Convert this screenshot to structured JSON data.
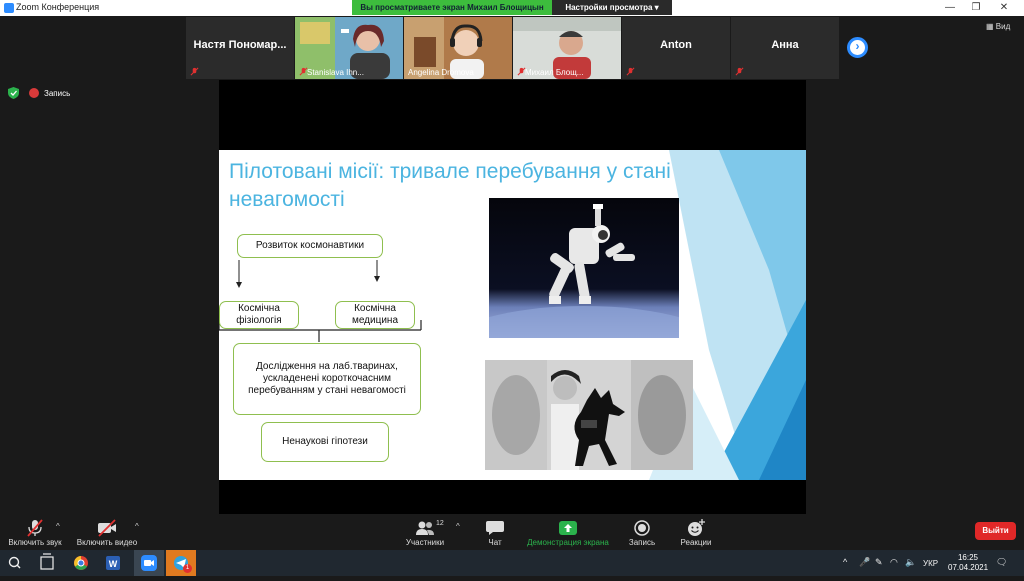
{
  "window": {
    "title": "Zoom Конференция",
    "controls": [
      "—",
      "❐",
      "✕"
    ]
  },
  "share_banner": {
    "text": "Вы просматриваете экран Михаил Блощицын",
    "options_label": "Настройки просмотра ▾"
  },
  "participants": [
    {
      "name": "Настя Пономар...",
      "kind": "name",
      "muted": true
    },
    {
      "name": "Stanislava Ihn...",
      "kind": "video",
      "muted": true
    },
    {
      "name": "Angelina Dromova",
      "kind": "video",
      "muted": false
    },
    {
      "name": "Михаил Блощ...",
      "kind": "video",
      "muted": true
    },
    {
      "name": "Anton",
      "kind": "name",
      "muted": true
    },
    {
      "name": "Анна",
      "kind": "name",
      "muted": true
    }
  ],
  "view_button": {
    "icon": "grid-icon",
    "label": "Вид"
  },
  "recording": {
    "label": "Запись"
  },
  "slide": {
    "title": "Пілотовані місії: тривале перебування у стані невагомості",
    "root": "Розвиток космонавтики",
    "branch_left": "Космічна фізіологія",
    "branch_right": "Космічна медицина",
    "research": "Дослідження на лаб.тваринах, ускладенені короткочасним перебуванням у стані невагомості",
    "pseudo": "Ненаукові гіпотези"
  },
  "toolbar": {
    "mute": "Включить звук",
    "video": "Включить видео",
    "participants": "Участники",
    "participants_count": "12",
    "chat": "Чат",
    "share": "Демонстрация экрана",
    "record": "Запись",
    "reactions": "Реакции",
    "leave": "Выйти"
  },
  "taskbar": {
    "language": "УКР",
    "time": "16:25",
    "date": "07.04.2021",
    "telegram_badge": "1"
  },
  "colors": {
    "accent": "#2d8cff",
    "share_green": "#3dbd3d",
    "leave_red": "#e02828",
    "slide_title": "#4bb4e0",
    "box_border": "#8fbf4f"
  }
}
